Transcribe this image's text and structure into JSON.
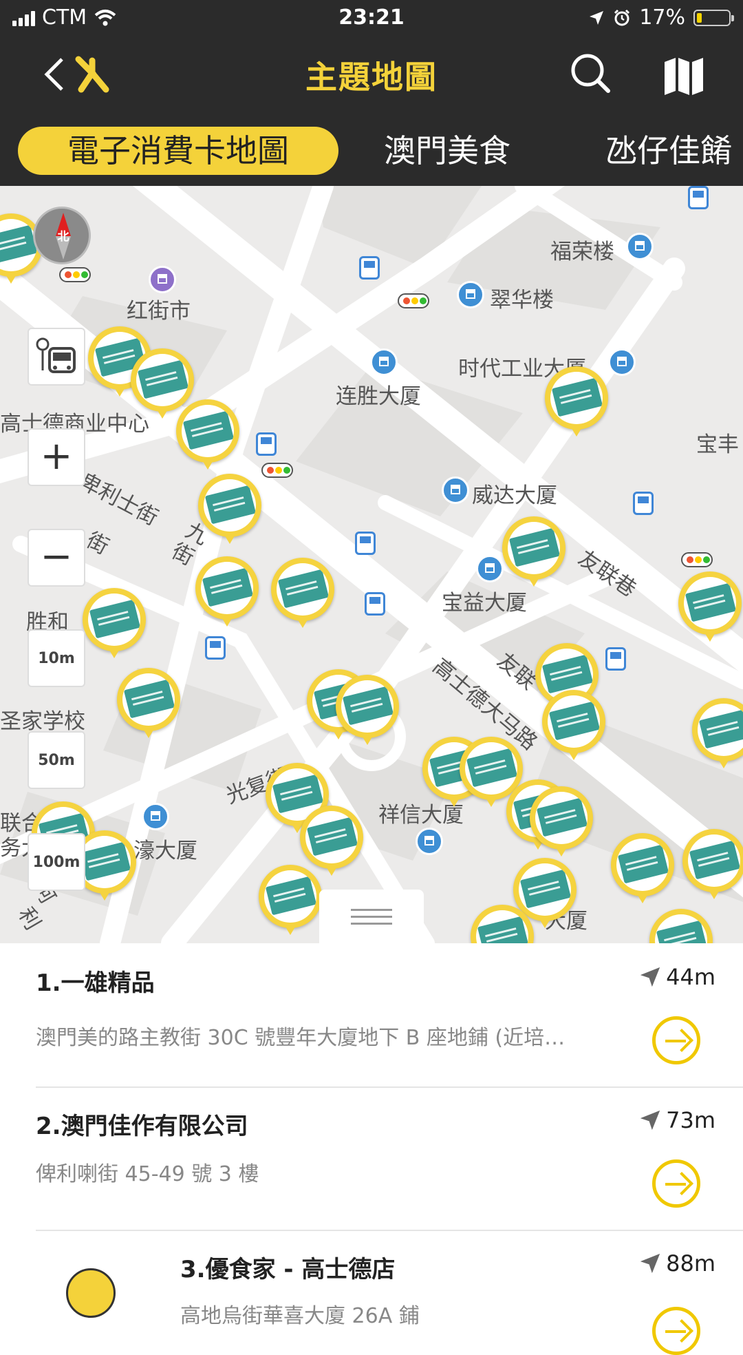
{
  "status_bar": {
    "carrier": "CTM",
    "time": "23:21",
    "battery": "17%",
    "battery_level": 0.17
  },
  "nav": {
    "title": "主題地圖",
    "back_icon": "chevron-left-icon",
    "logo_icon": "app-logo-icon",
    "search_icon": "search-icon",
    "map_icon": "folded-map-icon"
  },
  "tabs": [
    {
      "label": "電子消費卡地圖",
      "active": true
    },
    {
      "label": "澳門美食",
      "active": false
    },
    {
      "label": "氹仔佳餚",
      "active": false
    }
  ],
  "map": {
    "labels": {
      "fuwing": "福荣楼",
      "hongkaishi": "红街市",
      "chuiwalau": "翠华楼",
      "shidai": "时代工业大厦",
      "lianSheng": "连胜大厦",
      "gaoshide_com": "高士德商业中心",
      "weida": "威达大厦",
      "baofeng": "宝丰",
      "pilishi": "卑利士街",
      "jiu": "九",
      "jie": "街",
      "jie2": "街",
      "youlianxiang": "友联巷",
      "baoyi": "宝益大厦",
      "shenghe": "胜和",
      "shengjia": "圣家学校",
      "gaoshide_road": "高士德大马路",
      "youlian2": "友联",
      "guangfu": "光复街",
      "xiangxin": "祥信大厦",
      "lianhe": "联合",
      "wuda": "务大",
      "hao": "濠大厦",
      "dasha": "大厦",
      "li": "利",
      "a": "阿"
    },
    "compass_label": "北",
    "zoom_in": "+",
    "zoom_out": "−",
    "scales": [
      "10m",
      "50m",
      "100m"
    ]
  },
  "list": {
    "items": [
      {
        "title": "1.一雄精品",
        "address": "澳門美的路主教街 30C 號豐年大廈地下 B 座地鋪 (近培…",
        "distance": "44m"
      },
      {
        "title": "2.澳門佳作有限公司",
        "address": "俾利喇街 45-49 號 3 樓",
        "distance": "73m"
      },
      {
        "title": "3.優食家 - 高士德店",
        "address": "高地烏街華喜大廈 26A 鋪",
        "distance": "88m"
      }
    ]
  }
}
